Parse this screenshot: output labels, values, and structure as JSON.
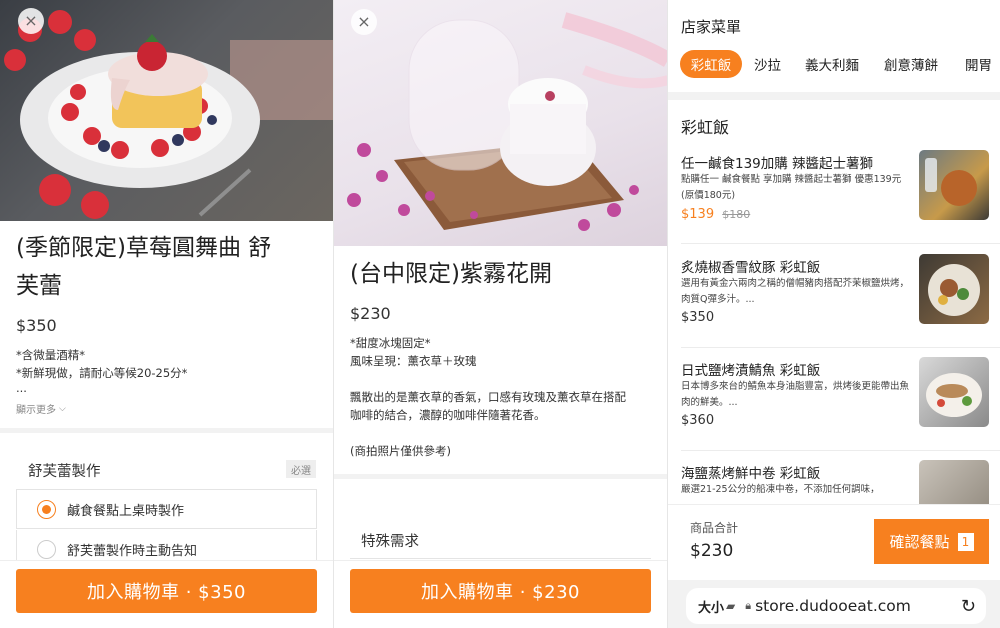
{
  "colors": {
    "accent": "#f7801f",
    "sale": "#f7801f"
  },
  "panel1": {
    "close_icon": "×",
    "title_line1": "(季節限定)草莓圓舞曲 舒",
    "title_line2": "芙蕾",
    "price": "$350",
    "desc": [
      "*含微量酒精*",
      "*新鮮現做，請耐心等候20-25分*",
      "..."
    ],
    "show_more": "顯示更多",
    "section_title": "舒芙蕾製作",
    "required_badge": "必選",
    "options": [
      {
        "label": "鹹食餐點上桌時製作",
        "selected": true
      },
      {
        "label": "舒芙蕾製作時主動告知",
        "selected": false
      }
    ],
    "cart_button": "加入購物車 · $350"
  },
  "panel2": {
    "close_icon": "×",
    "title": "(台中限定)紫霧花開",
    "price": "$230",
    "desc": [
      "*甜度冰塊固定*",
      "風味呈現：薰衣草＋玫瑰",
      "",
      "飄散出的是薰衣草的香氣，口感有玫瑰及薰衣草在搭配",
      "咖啡的結合，濃醇的咖啡伴隨著花香。",
      "",
      "(商拍照片僅供參考)"
    ],
    "special_title": "特殊需求",
    "cart_button": "加入購物車 · $230"
  },
  "panel3": {
    "header": "店家菜單",
    "tabs": [
      "彩虹飯",
      "沙拉",
      "義大利麵",
      "創意薄餅",
      "開胃"
    ],
    "section": "彩虹飯",
    "items": [
      {
        "name": "任一鹹食139加購 辣醬起士薯獅",
        "desc": "點購任一 鹹食餐點 享加購 辣醬起士薯獅 優惠139元 (原價180元)",
        "price": "$139",
        "old_price": "$180"
      },
      {
        "name": "炙燒椒香雪紋豚 彩虹飯",
        "desc": "選用有黃金六兩肉之稱的僧帽豬肉搭配芥茉椒鹽烘烤，肉質Q彈多汁。...",
        "price": "$350"
      },
      {
        "name": "日式鹽烤漬鯖魚 彩虹飯",
        "desc": "日本博多來台的鯖魚本身油脂豐富，烘烤後更能帶出魚肉的鮮美。...",
        "price": "$360"
      },
      {
        "name": "海鹽蒸烤鮮中卷 彩虹飯",
        "desc": "嚴選21-25公分的船凍中卷，不添加任何調味，",
        "price": ""
      }
    ],
    "subtotal_label": "商品合計",
    "subtotal": "$230",
    "confirm_button": "確認餐點",
    "confirm_count": "1",
    "browser_text_size": "大小",
    "url": "store.dudooeat.com"
  }
}
